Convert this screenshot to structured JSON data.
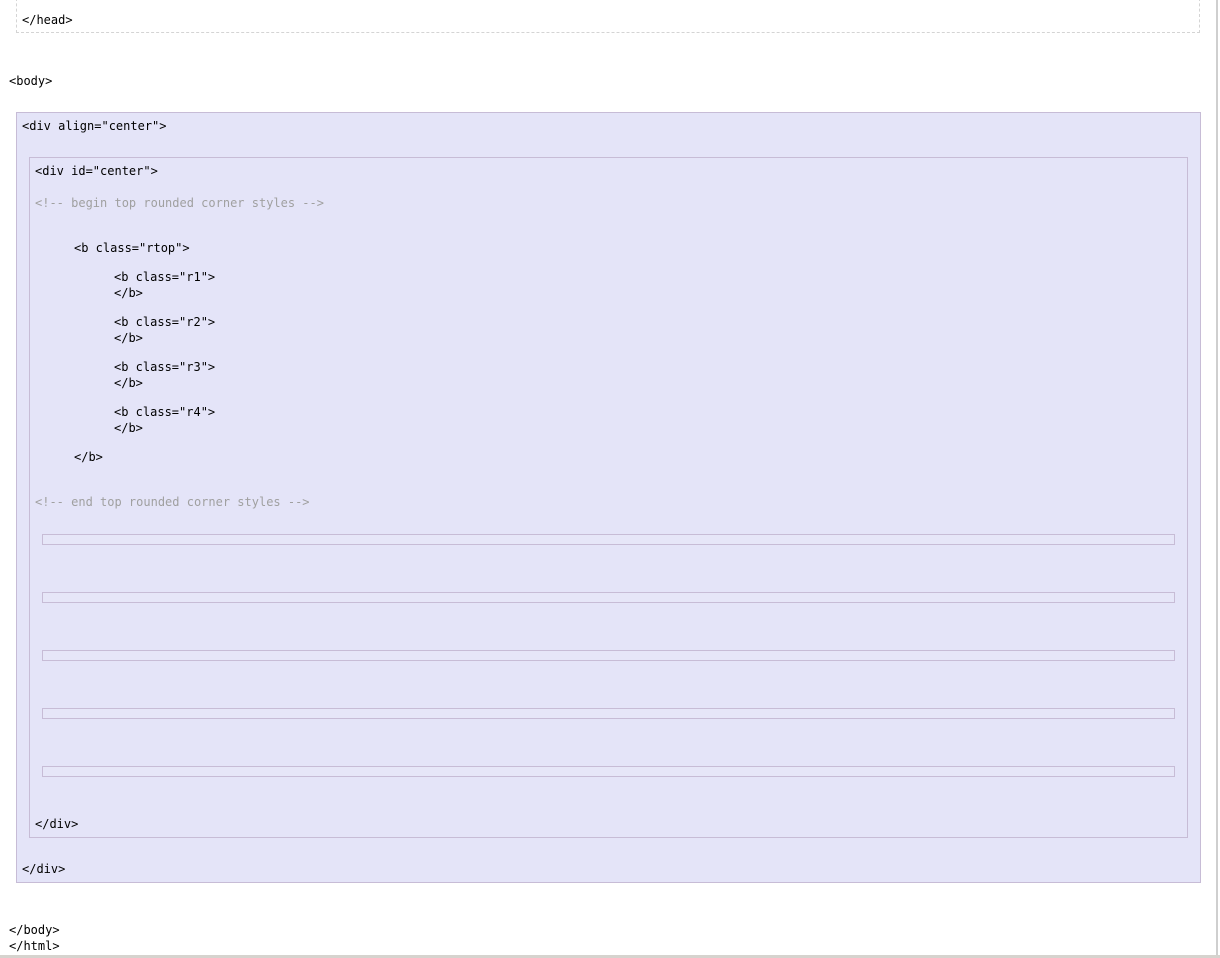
{
  "code": {
    "head_close": "</head>",
    "body_open": "<body>",
    "div_align_open": "<div align=\"center\">",
    "div_id_open": "<div id=\"center\">",
    "comment_begin": "<!-- begin top rounded corner styles -->",
    "b_rtop_open": "<b class=\"rtop\">",
    "b_r1_open": "<b class=\"r1\">",
    "b_r2_open": "<b class=\"r2\">",
    "b_r3_open": "<b class=\"r3\">",
    "b_r4_open": "<b class=\"r4\">",
    "b_close": "</b>",
    "comment_end": "<!-- end top rounded corner styles -->",
    "div_close": "</div>",
    "body_close": "</body>",
    "html_close": "</html>"
  }
}
